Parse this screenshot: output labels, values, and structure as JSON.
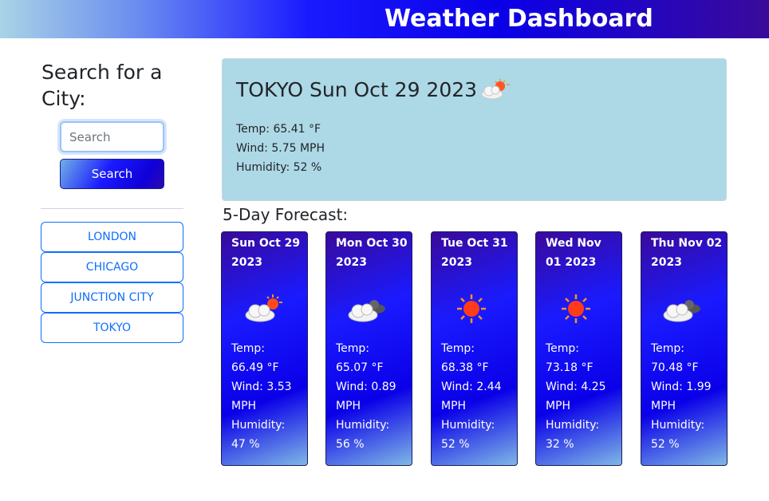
{
  "header": {
    "title": "Weather Dashboard"
  },
  "sidebar": {
    "heading": "Search for a City:",
    "search_placeholder": "Search",
    "search_button": "Search",
    "history": [
      "LONDON",
      "CHICAGO",
      "JUNCTION CITY",
      "TOKYO"
    ]
  },
  "current": {
    "title": "TOKYO Sun Oct 29 2023",
    "icon": "partly-cloudy-icon",
    "temp": "Temp: 65.41 °F",
    "wind": "Wind: 5.75 MPH",
    "humidity": "Humidity: 52 %"
  },
  "forecast": {
    "heading": "5-Day Forecast:",
    "days": [
      {
        "date": "Sun Oct 29 2023",
        "icon": "partly-cloudy-icon",
        "temp_label": "Temp:",
        "temp": "66.49 °F",
        "wind_label": "Wind: 3.53",
        "wind_unit": "MPH",
        "humidity_label": "Humidity:",
        "humidity": "47 %"
      },
      {
        "date": "Mon Oct 30 2023",
        "icon": "cloudy-icon",
        "temp_label": "Temp:",
        "temp": "65.07 °F",
        "wind_label": "Wind: 0.89",
        "wind_unit": "MPH",
        "humidity_label": "Humidity:",
        "humidity": "56 %"
      },
      {
        "date": "Tue Oct 31 2023",
        "icon": "sun-icon",
        "temp_label": "Temp:",
        "temp": "68.38 °F",
        "wind_label": "Wind: 2.44",
        "wind_unit": "MPH",
        "humidity_label": "Humidity:",
        "humidity": "52 %"
      },
      {
        "date": "Wed Nov 01 2023",
        "icon": "sun-icon",
        "temp_label": "Temp:",
        "temp": "73.18 °F",
        "wind_label": "Wind: 4.25",
        "wind_unit": "MPH",
        "humidity_label": "Humidity:",
        "humidity": "32 %"
      },
      {
        "date": "Thu Nov 02 2023",
        "icon": "cloudy-icon",
        "temp_label": "Temp:",
        "temp": "70.48 °F",
        "wind_label": "Wind: 1.99",
        "wind_unit": "MPH",
        "humidity_label": "Humidity:",
        "humidity": "52 %"
      }
    ]
  },
  "colors": {
    "accent": "#0d6efd",
    "current_bg": "#add8e6",
    "header_start": "#a9d3e6",
    "header_end": "#3a0a9a"
  }
}
